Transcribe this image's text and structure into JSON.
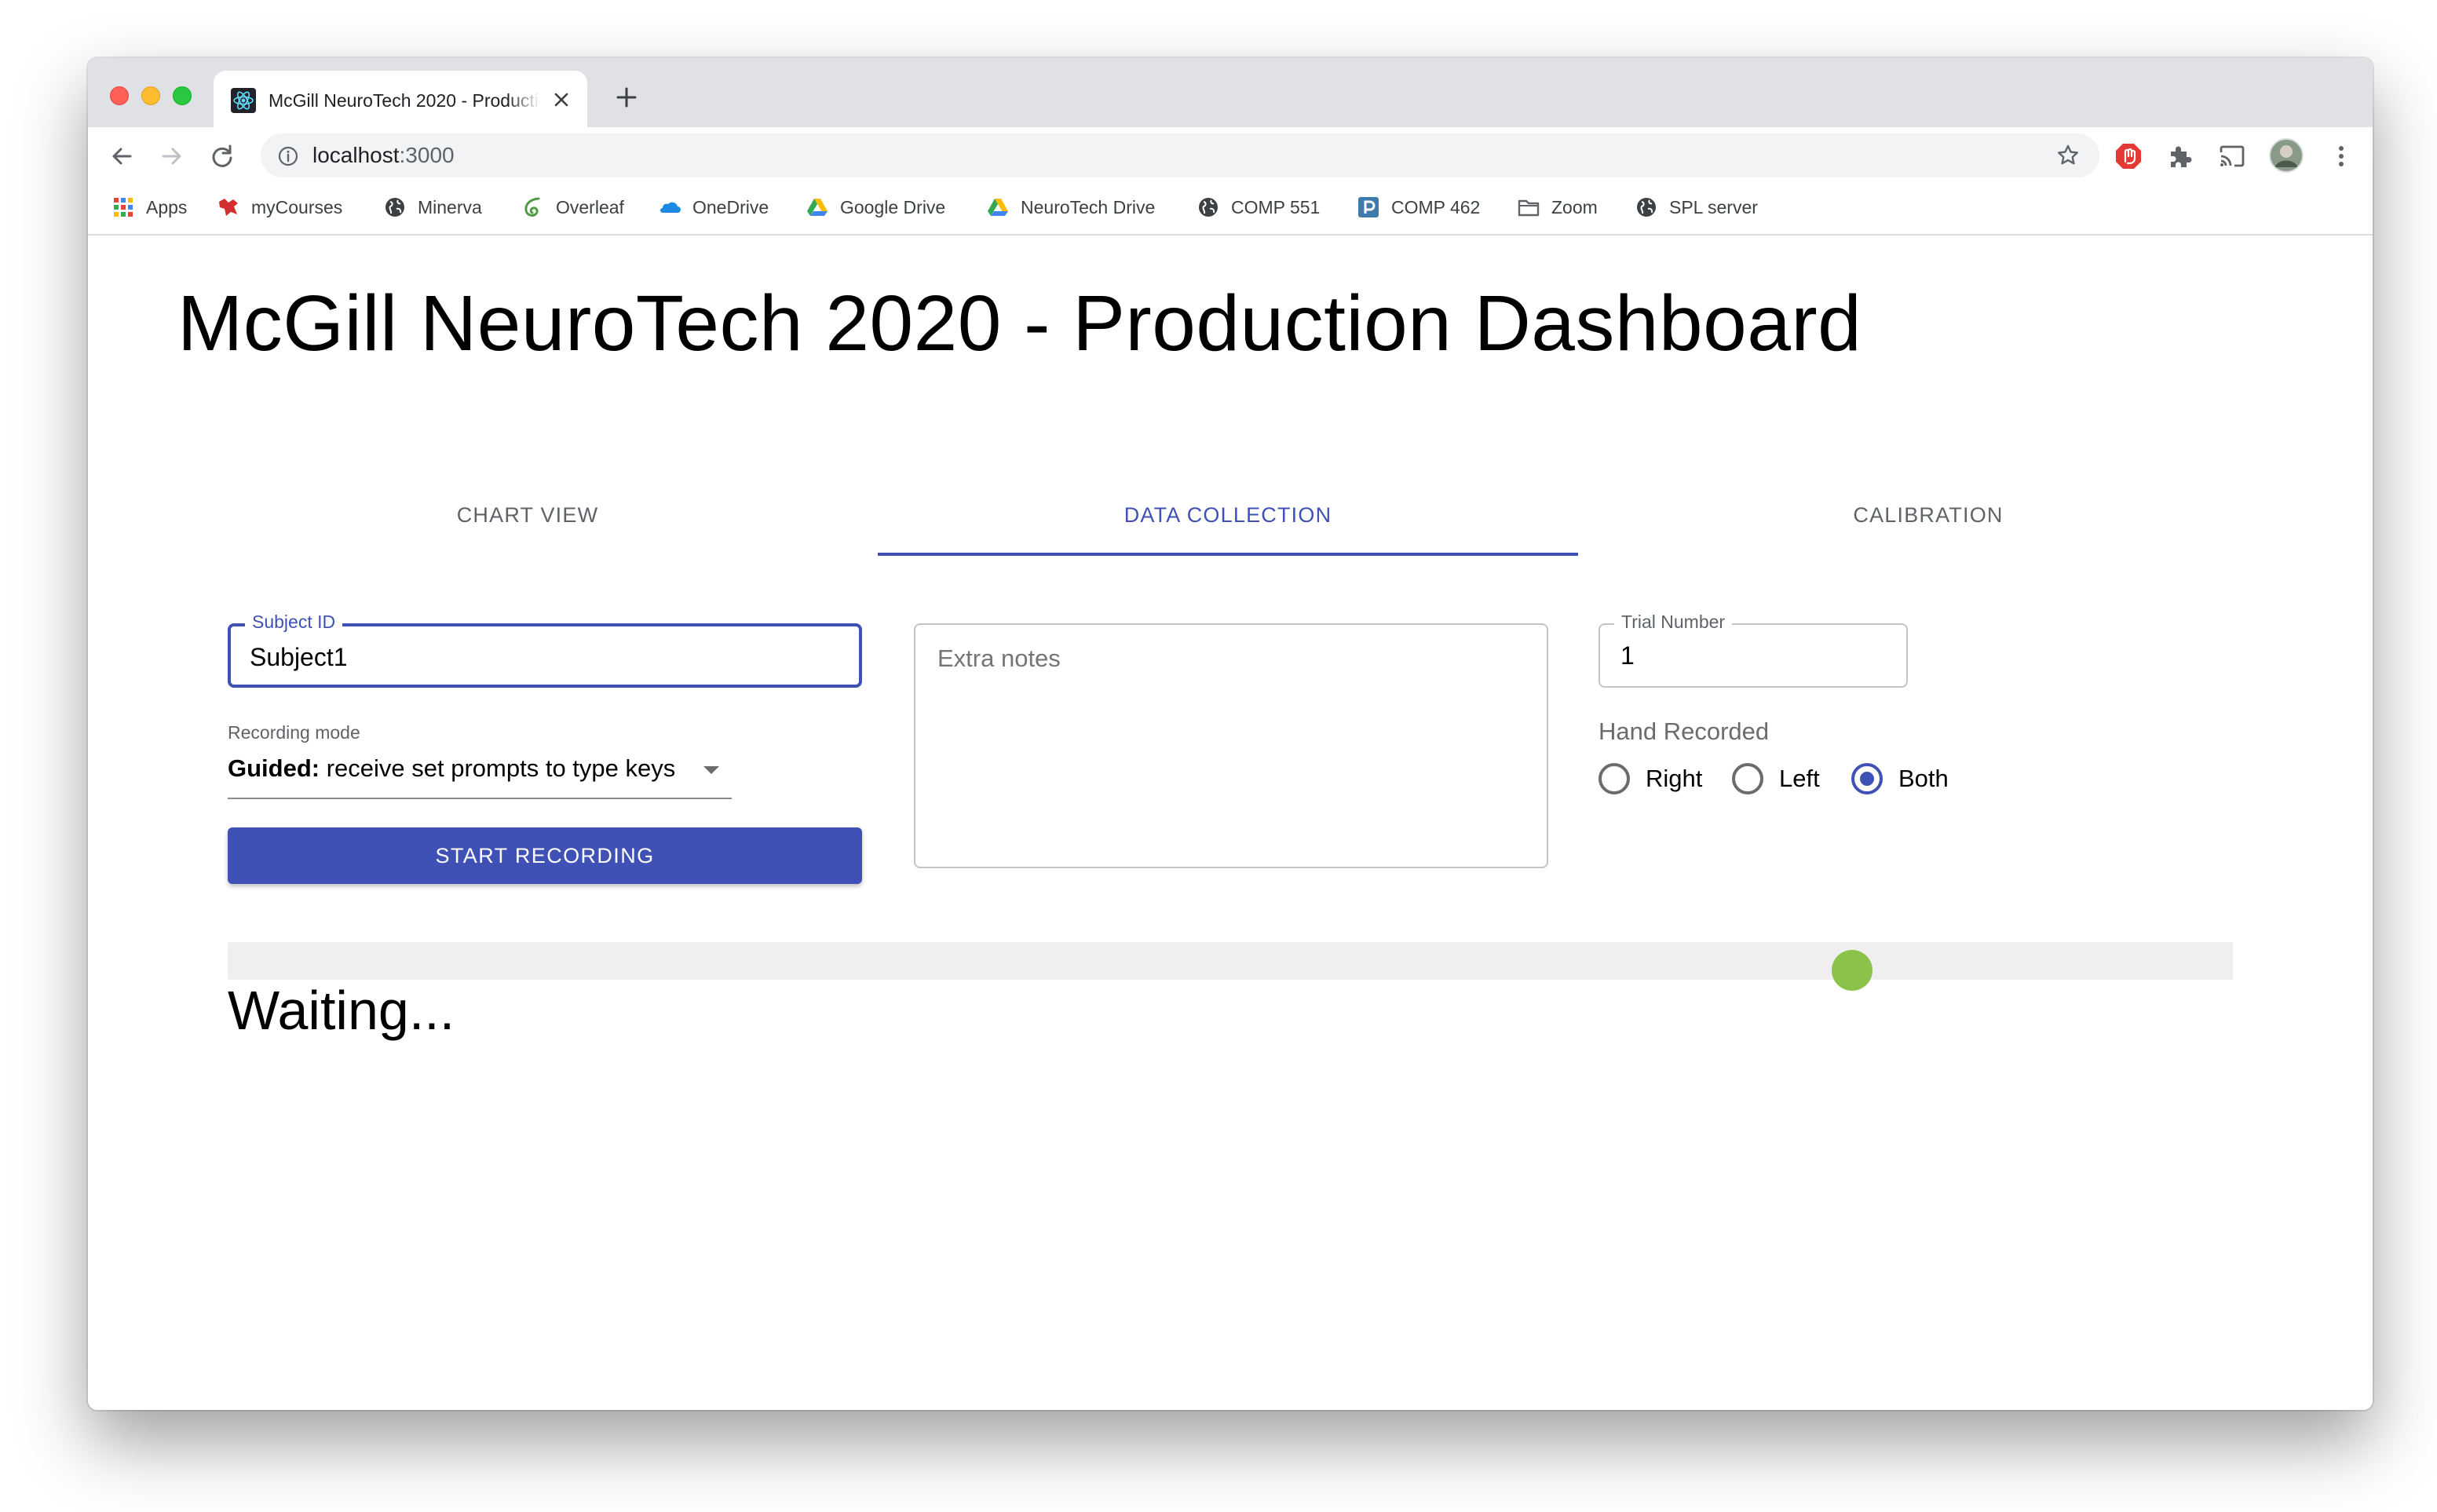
{
  "browser": {
    "tab_title": "McGill NeuroTech 2020 - Production Dashboard",
    "url_host": "localhost",
    "url_port": ":3000"
  },
  "bookmarks": [
    {
      "label": "Apps",
      "icon": "apps-grid-icon"
    },
    {
      "label": "myCourses",
      "icon": "mcgill-icon"
    },
    {
      "label": "Minerva",
      "icon": "globe-icon"
    },
    {
      "label": "Overleaf",
      "icon": "overleaf-icon"
    },
    {
      "label": "OneDrive",
      "icon": "onedrive-icon"
    },
    {
      "label": "Google Drive",
      "icon": "google-drive-icon"
    },
    {
      "label": "NeuroTech Drive",
      "icon": "google-drive-icon"
    },
    {
      "label": "COMP 551",
      "icon": "globe-icon"
    },
    {
      "label": "COMP 462",
      "icon": "piazza-icon"
    },
    {
      "label": "Zoom",
      "icon": "folder-icon"
    },
    {
      "label": "SPL server",
      "icon": "globe-icon"
    }
  ],
  "page": {
    "title": "McGill NeuroTech 2020 - Production Dashboard",
    "tabs": [
      {
        "label": "CHART VIEW",
        "active": false
      },
      {
        "label": "DATA COLLECTION",
        "active": true
      },
      {
        "label": "CALIBRATION",
        "active": false
      }
    ]
  },
  "form": {
    "subject_id_label": "Subject ID",
    "subject_id_value": "Subject1",
    "recording_mode_label": "Recording mode",
    "recording_mode_bold": "Guided:",
    "recording_mode_rest": " receive set prompts to type keys",
    "start_button": "START RECORDING",
    "notes_placeholder": "Extra notes",
    "trial_label": "Trial Number",
    "trial_value": "1",
    "hand_label": "Hand Recorded",
    "hand_options": [
      "Right",
      "Left",
      "Both"
    ],
    "hand_selected": "Both"
  },
  "progress": {
    "indicator_position": 0.81,
    "indicator_color": "#8bc34a",
    "status_text": "Waiting..."
  },
  "colors": {
    "primary": "#3f51b5",
    "indicator": "#8bc34a"
  }
}
